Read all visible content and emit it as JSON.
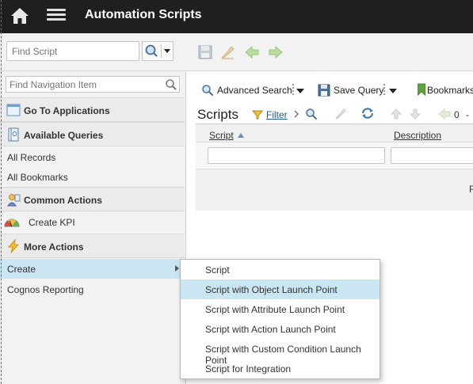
{
  "app": {
    "title": "Automation Scripts"
  },
  "toolbar": {
    "find_placeholder": "Find Script"
  },
  "leftnav": {
    "search_placeholder": "Find Navigation Item",
    "go_to_applications": "Go To Applications",
    "available_queries": "Available Queries",
    "all_records": "All Records",
    "all_bookmarks": "All Bookmarks",
    "common_actions": "Common Actions",
    "create_kpi": "Create KPI",
    "more_actions": "More Actions",
    "create": "Create",
    "cognos_reporting": "Cognos Reporting"
  },
  "main": {
    "advanced_search": "Advanced Search",
    "save_query": "Save Query",
    "bookmarks": "Bookmarks",
    "title": "Scripts",
    "filter": "Filter",
    "row_count": "0",
    "row_count_sep": "-",
    "columns": [
      "Script",
      "Description"
    ],
    "pager_fragment": "F"
  },
  "popup": {
    "items": [
      "Script",
      "Script with Object Launch Point",
      "Script with Attribute Launch Point",
      "Script with Action Launch Point",
      "Script with Custom Condition Launch Point",
      "Script for Integration"
    ],
    "active_index": 1
  },
  "colors": {
    "titlebar": "#1f1f1f",
    "highlight": "#c9e6f2",
    "link": "#1a5a96"
  }
}
